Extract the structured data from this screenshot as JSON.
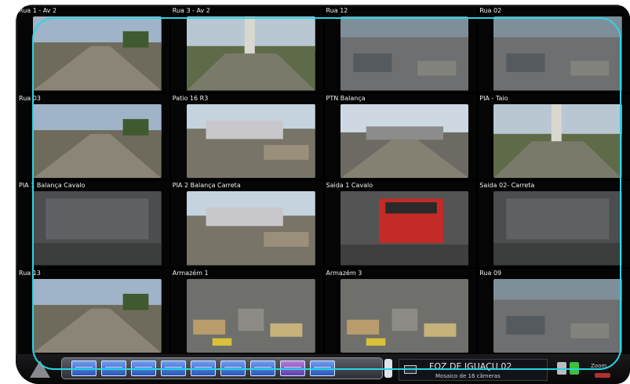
{
  "cameras": [
    {
      "label": "Rua 1 - Av 2",
      "scene": "road"
    },
    {
      "label": "Rua 3 - Av 2",
      "scene": "trees"
    },
    {
      "label": "Rua 12",
      "scene": "lot"
    },
    {
      "label": "Rua 02",
      "scene": "lot"
    },
    {
      "label": "Rua 03",
      "scene": "road"
    },
    {
      "label": "Patio 16 R3",
      "scene": "trucks"
    },
    {
      "label": "PTN Balança",
      "scene": "gate"
    },
    {
      "label": "PIA - Taio",
      "scene": "trees"
    },
    {
      "label": "PIA 1 Balança Cavalo",
      "scene": "scale"
    },
    {
      "label": "PIA 2 Balança Carreta",
      "scene": "trucks"
    },
    {
      "label": "Saida 1 Cavalo",
      "scene": "redtruck"
    },
    {
      "label": "Saida 02- Carreta",
      "scene": "scale"
    },
    {
      "label": "Rua 13",
      "scene": "road"
    },
    {
      "label": "Armazém 1",
      "scene": "warehouse"
    },
    {
      "label": "Armazém 3",
      "scene": "warehouse"
    },
    {
      "label": "Rua 09",
      "scene": "lot"
    }
  ],
  "taskbar": {
    "location": "FOZ DE IGUAÇU 02",
    "mosaic_label": "Mosaico de 16 câmeras",
    "side_label": "Zoom",
    "layout_buttons": 9
  },
  "colors": {
    "highlight_frame": "#28d6e6",
    "layout_button": "#2a56b8"
  }
}
